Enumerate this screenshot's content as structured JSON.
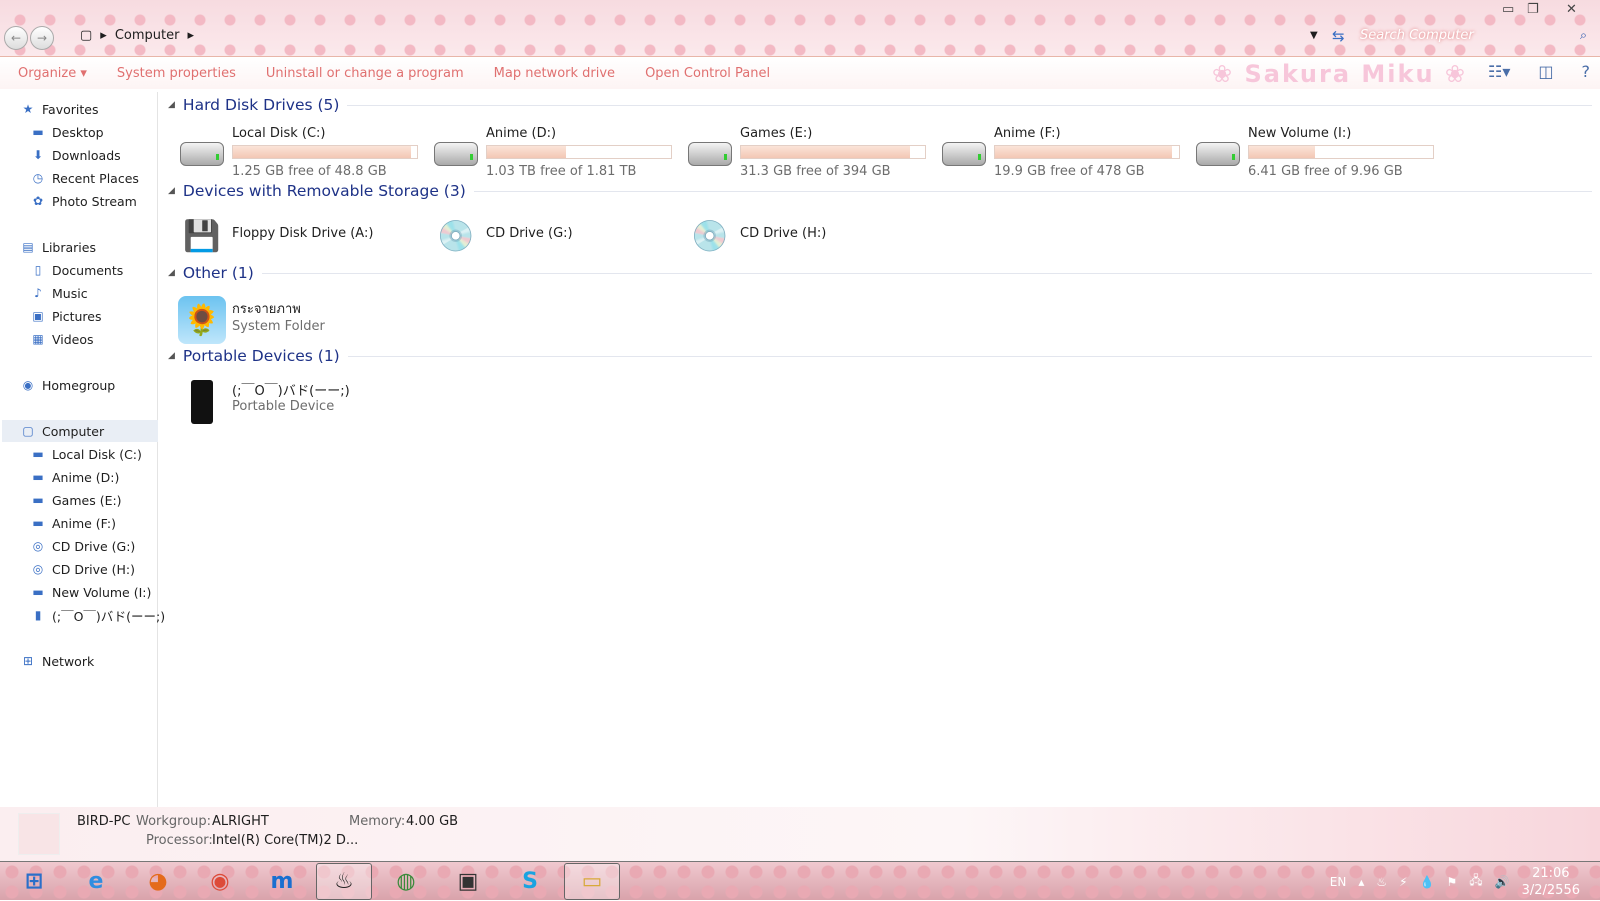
{
  "window": {
    "minimize": "▭",
    "restore": "❐",
    "close": "✕"
  },
  "address": {
    "crumb": "Computer",
    "search_placeholder": "Search Computer"
  },
  "toolbar": {
    "items": [
      "Organize ▾",
      "System properties",
      "Uninstall or change a program",
      "Map network drive",
      "Open Control Panel"
    ],
    "logo": "❀ Sakura Miku ❀"
  },
  "sidebar": {
    "items": [
      {
        "label": "Favorites",
        "icon": "★",
        "indent": 0
      },
      {
        "label": "Desktop",
        "icon": "▬",
        "indent": 1
      },
      {
        "label": "Downloads",
        "icon": "⬇",
        "indent": 1
      },
      {
        "label": "Recent Places",
        "icon": "◷",
        "indent": 1
      },
      {
        "label": "Photo Stream",
        "icon": "✿",
        "indent": 1
      },
      {
        "label": "Libraries",
        "icon": "▤",
        "indent": 0
      },
      {
        "label": "Documents",
        "icon": "▯",
        "indent": 1
      },
      {
        "label": "Music",
        "icon": "♪",
        "indent": 1
      },
      {
        "label": "Pictures",
        "icon": "▣",
        "indent": 1
      },
      {
        "label": "Videos",
        "icon": "▦",
        "indent": 1
      },
      {
        "label": "Homegroup",
        "icon": "◉",
        "indent": 0
      },
      {
        "label": "Computer",
        "icon": "▢",
        "indent": 0,
        "selected": true
      },
      {
        "label": "Local Disk (C:)",
        "icon": "▬",
        "indent": 1
      },
      {
        "label": "Anime (D:)",
        "icon": "▬",
        "indent": 1
      },
      {
        "label": "Games (E:)",
        "icon": "▬",
        "indent": 1
      },
      {
        "label": "Anime (F:)",
        "icon": "▬",
        "indent": 1
      },
      {
        "label": "CD Drive (G:)",
        "icon": "◎",
        "indent": 1
      },
      {
        "label": "CD Drive (H:)",
        "icon": "◎",
        "indent": 1
      },
      {
        "label": "New Volume (I:)",
        "icon": "▬",
        "indent": 1
      },
      {
        "label": "(;￣O￣)バド(ーー;)",
        "icon": "▮",
        "indent": 1
      },
      {
        "label": "Network",
        "icon": "⊞",
        "indent": 0
      }
    ]
  },
  "groups": {
    "hdd": {
      "title": "Hard Disk Drives (5)",
      "drives": [
        {
          "name": "Local Disk (C:)",
          "free": "1.25 GB free of 48.8 GB",
          "used_pct": 97
        },
        {
          "name": "Anime (D:)",
          "free": "1.03 TB free of 1.81 TB",
          "used_pct": 43
        },
        {
          "name": "Games (E:)",
          "free": "31.3 GB free of 394 GB",
          "used_pct": 92
        },
        {
          "name": "Anime (F:)",
          "free": "19.9 GB free of 478 GB",
          "used_pct": 96
        },
        {
          "name": "New Volume (I:)",
          "free": "6.41 GB free of 9.96 GB",
          "used_pct": 36
        }
      ]
    },
    "removable": {
      "title": "Devices with Removable Storage (3)",
      "items": [
        "Floppy Disk Drive (A:)",
        "CD Drive (G:)",
        "CD Drive (H:)"
      ]
    },
    "other": {
      "title": "Other (1)",
      "name": "กระจายภาพ",
      "type": "System Folder"
    },
    "portable": {
      "title": "Portable Devices (1)",
      "name": "(;￣O￣)バド(ーー;)",
      "type": "Portable Device"
    }
  },
  "details": {
    "pc": "BIRD-PC",
    "workgroup_label": "Workgroup:",
    "workgroup": "ALRIGHT",
    "memory_label": "Memory:",
    "memory": "4.00 GB",
    "processor_label": "Processor:",
    "processor": "Intel(R) Core(TM)2 D..."
  },
  "taskbar": {
    "apps": [
      "⊞",
      "e",
      "◕",
      "◉",
      "m",
      "♨",
      "◍",
      "▣",
      "S",
      "▭"
    ],
    "lang": "EN",
    "time": "21:06",
    "date": "3/2/2556"
  }
}
